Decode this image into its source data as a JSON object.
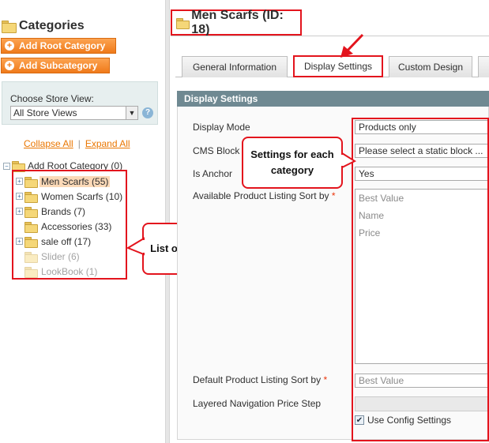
{
  "sidebar": {
    "title": "Categories",
    "add_root_label": "Add Root Category",
    "add_sub_label": "Add Subcategory",
    "store_view_label": "Choose Store View:",
    "store_view_value": "All Store Views",
    "collapse_all": "Collapse All",
    "expand_all": "Expand All",
    "separator": "|",
    "root_label": "Add Root Category (0)",
    "tree": [
      {
        "label": "Men Scarfs (55)",
        "selected": true,
        "disabled": false,
        "expander": "+"
      },
      {
        "label": "Women Scarfs (10)",
        "selected": false,
        "disabled": false,
        "expander": "+"
      },
      {
        "label": "Brands (7)",
        "selected": false,
        "disabled": false,
        "expander": "+"
      },
      {
        "label": "Accessories (33)",
        "selected": false,
        "disabled": false,
        "expander": ""
      },
      {
        "label": "sale off (17)",
        "selected": false,
        "disabled": false,
        "expander": "+"
      },
      {
        "label": "Slider (6)",
        "selected": false,
        "disabled": true,
        "expander": ""
      },
      {
        "label": "LookBook (1)",
        "selected": false,
        "disabled": true,
        "expander": ""
      }
    ]
  },
  "annotations": {
    "list_callout": "List of categories",
    "settings_callout": "Settings for each category"
  },
  "main": {
    "page_title": "Men Scarfs (ID: 18)",
    "tabs": [
      "General Information",
      "Display Settings",
      "Custom Design"
    ],
    "active_tab": "Display Settings",
    "section_title": "Display Settings",
    "fields": {
      "display_mode_label": "Display Mode",
      "display_mode_value": "Products only",
      "cms_block_label": "CMS Block",
      "cms_block_value": "Please select a static block ...",
      "is_anchor_label": "Is Anchor",
      "is_anchor_value": "Yes",
      "sort_by_label": "Available Product Listing Sort by",
      "sort_by_options": [
        "Best Value",
        "Name",
        "Price"
      ],
      "default_sort_label": "Default Product Listing Sort by",
      "default_sort_value": "Best Value",
      "price_step_label": "Layered Navigation Price Step",
      "use_config_label": "Use Config Settings",
      "use_config_checked": true,
      "required_marker": "*"
    }
  },
  "colors": {
    "accent_orange": "#ef7a1a",
    "annotation_red": "#e3141d",
    "section_header": "#6f8992",
    "selected_bg": "#fbd9b7"
  }
}
